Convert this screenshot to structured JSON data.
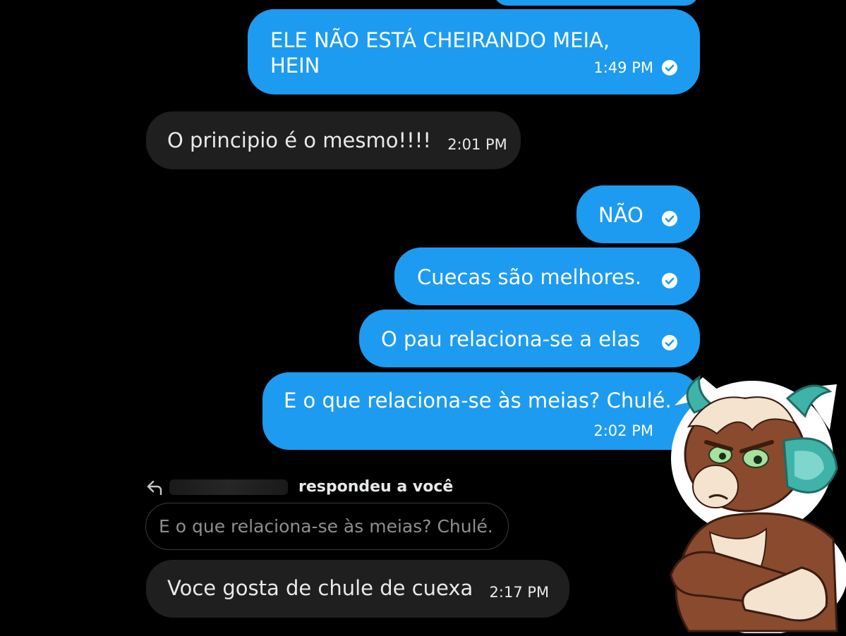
{
  "colors": {
    "sent": "#1d9bf0",
    "received": "#1f1f1f",
    "background": "#000000"
  },
  "messages": [
    {
      "text": "ELE NÃO ESTÁ CHEIRANDO MEIA, HEIN",
      "time": "1:49 PM",
      "direction": "sent"
    },
    {
      "text": "O principio é o mesmo!!!!",
      "time": "2:01 PM",
      "direction": "received"
    },
    {
      "text": "NÃO",
      "direction": "sent"
    },
    {
      "text": "Cuecas são melhores.",
      "direction": "sent"
    },
    {
      "text": "O pau relaciona-se a elas",
      "direction": "sent"
    },
    {
      "text": "E o que relaciona-se às meias? Chulé.",
      "time": "2:02 PM",
      "direction": "sent"
    }
  ],
  "reply": {
    "label": "respondeu a você",
    "quoted": "E o que relaciona-se às meias? Chulé.",
    "text": "Voce gosta de chule de cuexa",
    "time": "2:17 PM"
  },
  "icons": [
    "reply-arrow-icon",
    "read-check-icon"
  ]
}
